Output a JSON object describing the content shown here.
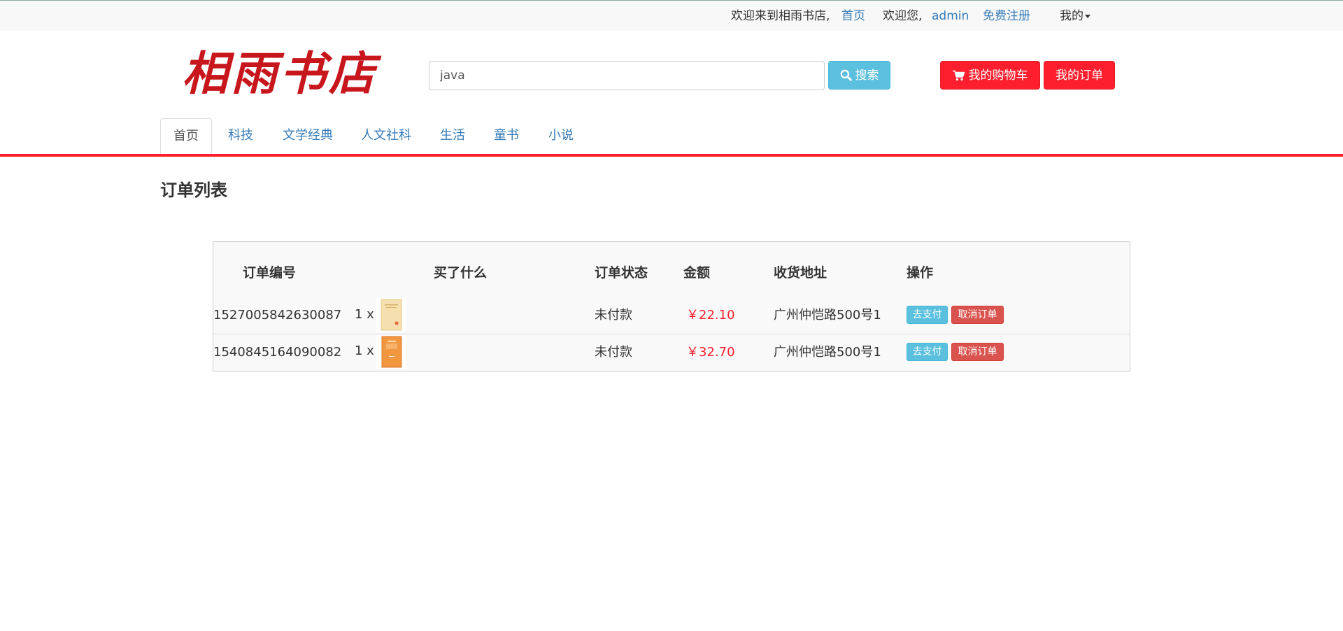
{
  "topbar": {
    "welcome_store": "欢迎来到相雨书店,",
    "home_link": "首页",
    "welcome_user": "欢迎您,",
    "username": "admin",
    "register_link": "免费注册",
    "my_menu": "我的"
  },
  "logo_text": "相雨书店",
  "search": {
    "value": "java",
    "button_label": "搜索"
  },
  "header_buttons": {
    "cart_label": "我的购物车",
    "orders_label": "我的订单"
  },
  "nav": {
    "tabs": [
      "首页",
      "科技",
      "文学经典",
      "人文社科",
      "生活",
      "童书",
      "小说"
    ]
  },
  "page_title": "订单列表",
  "table": {
    "headers": [
      "订单编号",
      "买了什么",
      "订单状态",
      "金额",
      "收货地址",
      "操作"
    ],
    "rows": [
      {
        "order_id": "1527005842630087",
        "qty": "1 x",
        "status": "未付款",
        "amount": "￥22.10",
        "address": "广州仲恺路500号1",
        "pay_label": "去支付",
        "cancel_label": "取消订单"
      },
      {
        "order_id": "1540845164090082",
        "qty": "1 x",
        "status": "未付款",
        "amount": "￥32.70",
        "address": "广州仲恺路500号1",
        "pay_label": "去支付",
        "cancel_label": "取消订单"
      }
    ]
  },
  "colors": {
    "brand_red": "#fe1f2e",
    "info_blue": "#5bc0de",
    "danger_red": "#d9534f",
    "link_blue": "#337ab7"
  }
}
